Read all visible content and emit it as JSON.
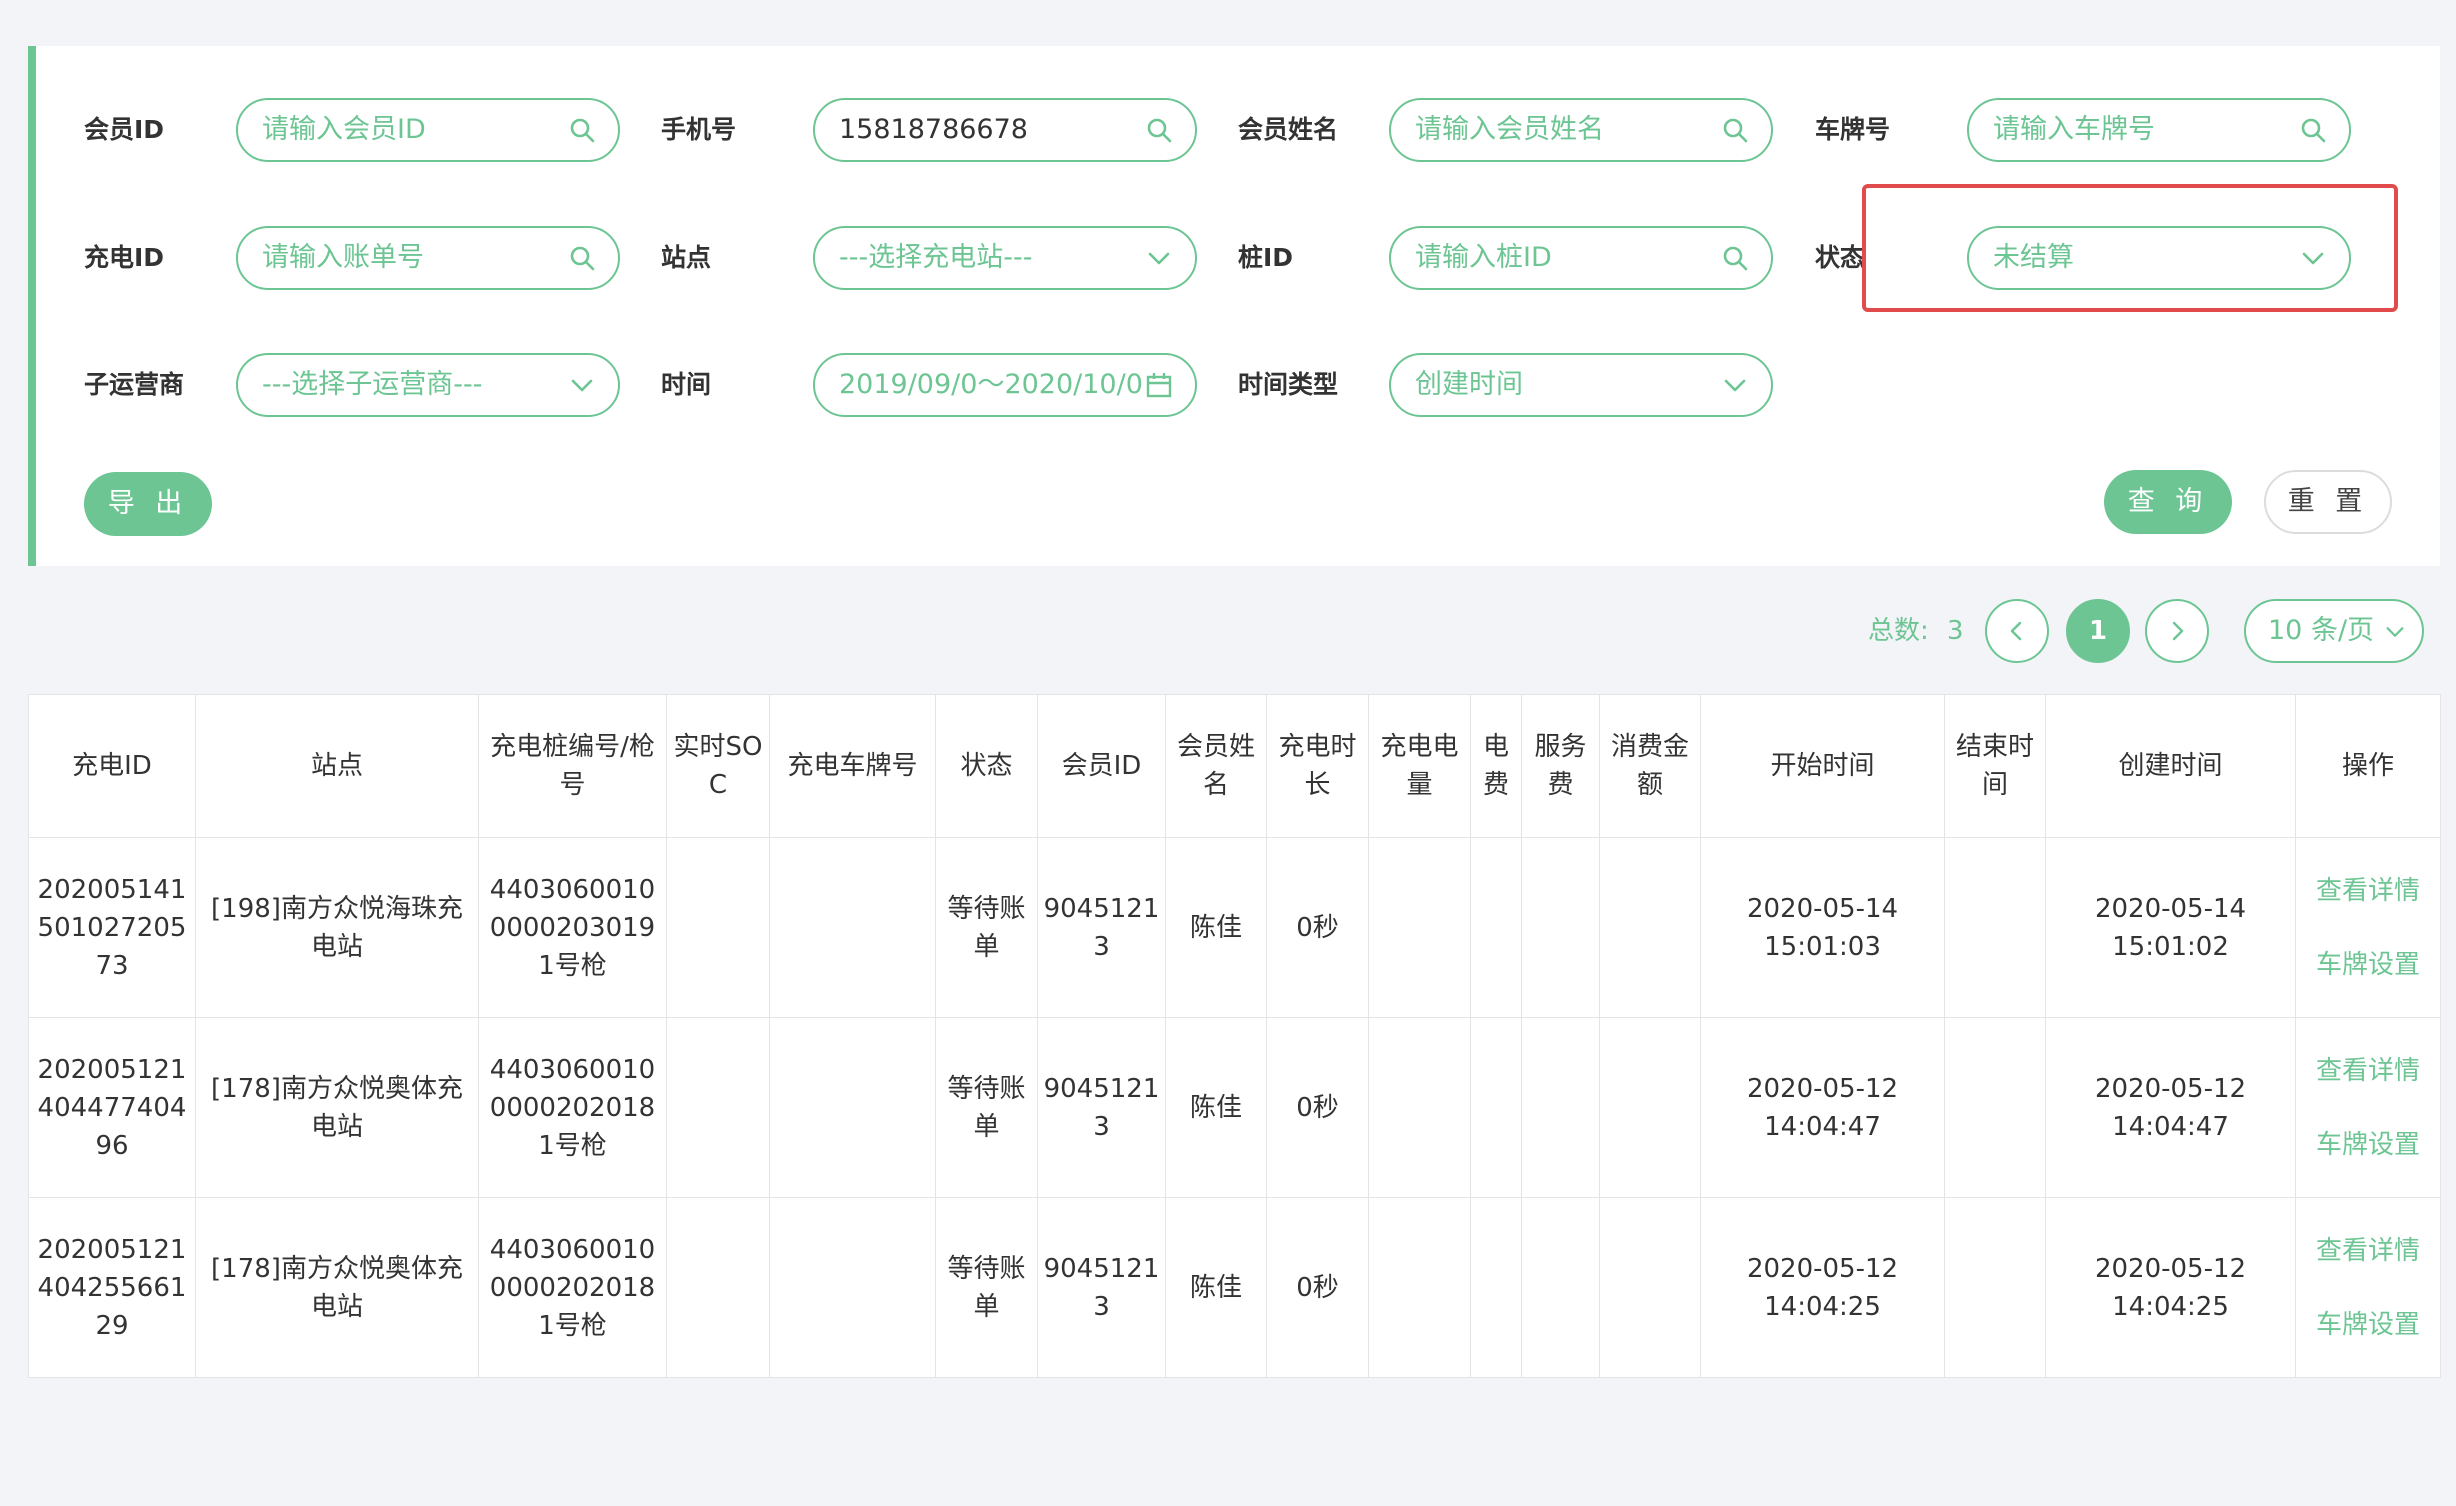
{
  "colors": {
    "accent": "#6cc593",
    "highlight": "#e14b4b",
    "background": "#f3f4f7"
  },
  "filters": {
    "member_id": {
      "label": "会员ID",
      "placeholder": "请输入会员ID",
      "icon": "search-icon"
    },
    "phone": {
      "label": "手机号",
      "value": "15818786678",
      "icon": "search-icon"
    },
    "member_name": {
      "label": "会员姓名",
      "placeholder": "请输入会员姓名",
      "icon": "search-icon"
    },
    "plate": {
      "label": "车牌号",
      "placeholder": "请输入车牌号",
      "icon": "search-icon"
    },
    "charge_id": {
      "label": "充电ID",
      "placeholder": "请输入账单号",
      "icon": "search-icon"
    },
    "station": {
      "label": "站点",
      "placeholder": "---选择充电站---",
      "icon": "chevron-down-icon"
    },
    "pile_id": {
      "label": "桩ID",
      "placeholder": "请输入桩ID",
      "icon": "search-icon"
    },
    "status": {
      "label": "状态",
      "value": "未结算",
      "icon": "chevron-down-icon"
    },
    "sub_operator": {
      "label": "子运营商",
      "placeholder": "---选择子运营商---",
      "icon": "chevron-down-icon"
    },
    "time": {
      "label": "时间",
      "value": "2019/09/0～2020/10/0",
      "icon": "calendar-icon"
    },
    "time_type": {
      "label": "时间类型",
      "value": "创建时间",
      "icon": "chevron-down-icon"
    }
  },
  "buttons": {
    "export": "导 出",
    "query": "查 询",
    "reset": "重 置"
  },
  "pagination": {
    "total_label": "总数:",
    "total": "3",
    "current_page": "1",
    "page_size": "10 条/页"
  },
  "table": {
    "columns": [
      "充电ID",
      "站点",
      "充电桩编号/枪号",
      "实时SOC",
      "充电车牌号",
      "状态",
      "会员ID",
      "会员姓名",
      "充电时长",
      "充电电量",
      "电费",
      "服务费",
      "消费金额",
      "开始时间",
      "结束时间",
      "创建时间",
      "操作"
    ],
    "rows": [
      {
        "charge_id": "20200514150102720573",
        "station": "[198]南方众悦海珠充电站",
        "pile": "44030600100000203019",
        "gun": "1号枪",
        "soc": "",
        "plate": "",
        "status": "等待账单",
        "member_id": "90451213",
        "member_name": "陈佳",
        "duration": "0秒",
        "energy": "",
        "elec_fee": "",
        "service_fee": "",
        "amount": "",
        "start_date": "2020-05-14",
        "start_time": "15:01:03",
        "end_time": "",
        "create_date": "2020-05-14",
        "create_time": "15:01:02",
        "op_detail": "查看详情",
        "op_plate": "车牌设置"
      },
      {
        "charge_id": "20200512140447740496",
        "station": "[178]南方众悦奥体充电站",
        "pile": "44030600100000202018",
        "gun": "1号枪",
        "soc": "",
        "plate": "",
        "status": "等待账单",
        "member_id": "90451213",
        "member_name": "陈佳",
        "duration": "0秒",
        "energy": "",
        "elec_fee": "",
        "service_fee": "",
        "amount": "",
        "start_date": "2020-05-12",
        "start_time": "14:04:47",
        "end_time": "",
        "create_date": "2020-05-12",
        "create_time": "14:04:47",
        "op_detail": "查看详情",
        "op_plate": "车牌设置"
      },
      {
        "charge_id": "20200512140425566129",
        "station": "[178]南方众悦奥体充电站",
        "pile": "44030600100000202018",
        "gun": "1号枪",
        "soc": "",
        "plate": "",
        "status": "等待账单",
        "member_id": "90451213",
        "member_name": "陈佳",
        "duration": "0秒",
        "energy": "",
        "elec_fee": "",
        "service_fee": "",
        "amount": "",
        "start_date": "2020-05-12",
        "start_time": "14:04:25",
        "end_time": "",
        "create_date": "2020-05-12",
        "create_time": "14:04:25",
        "op_detail": "查看详情",
        "op_plate": "车牌设置"
      }
    ]
  }
}
